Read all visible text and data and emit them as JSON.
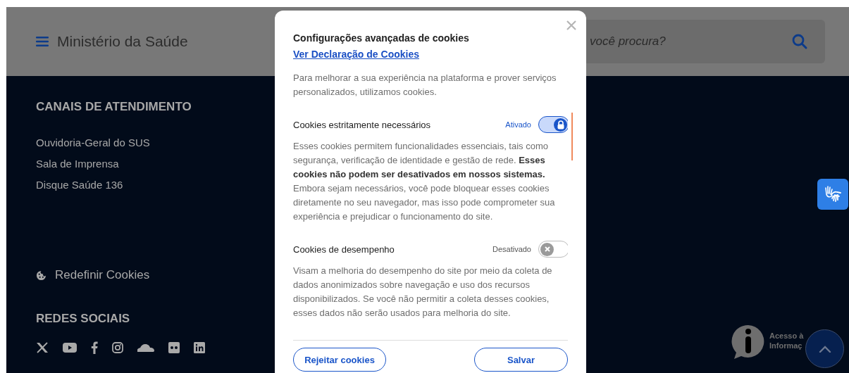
{
  "header": {
    "title": "Ministério da Saúde",
    "search": {
      "placeholder": "você procura?"
    }
  },
  "footer": {
    "channels_heading": "CANAIS DE ATENDIMENTO",
    "channels": [
      "Ouvidoria-Geral do SUS",
      "Sala de Imprensa",
      "Disque Saúde 136"
    ],
    "reset_cookies": "Redefinir Cookies",
    "social_heading": "REDES SOCIAIS",
    "social": [
      {
        "kind": "x"
      },
      {
        "kind": "youtube"
      },
      {
        "kind": "facebook"
      },
      {
        "kind": "instagram"
      },
      {
        "kind": "soundcloud"
      },
      {
        "kind": "flickr"
      },
      {
        "kind": "linkedin"
      }
    ]
  },
  "access_info": {
    "lines": [
      "Acesso à",
      "Informaç"
    ]
  },
  "modal": {
    "title": "Configurações avançadas de cookies",
    "link": "Ver Declaração de Cookies",
    "intro": "Para melhorar a sua experiência na plataforma e prover serviços personalizados, utilizamos cookies.",
    "sections": [
      {
        "title": "Cookies estritamente necessários",
        "status": "Ativado",
        "on": true,
        "locked": true,
        "description": "Esses cookies permitem funcionalidades essenciais, tais como segurança, verificação de identidade e gestão de rede. **Esses cookies não podem ser desativados em nossos sistemas.** Embora sejam necessários, você pode bloquear esses cookies diretamente no seu navegador, mas isso pode comprometer sua experiência e prejudicar o funcionamento do site."
      },
      {
        "title": "Cookies de desempenho",
        "status": "Desativado",
        "on": false,
        "locked": false,
        "description": "Visam a melhoria do desempenho do site por meio da coleta de dados anonimizados sobre navegação e uso dos recursos disponibilizados. Se você não permitir a coleta desses cookies, esses dados não serão usados para melhoria do site."
      }
    ],
    "buttons": [
      "Rejeitar cookies",
      "Salvar"
    ]
  }
}
